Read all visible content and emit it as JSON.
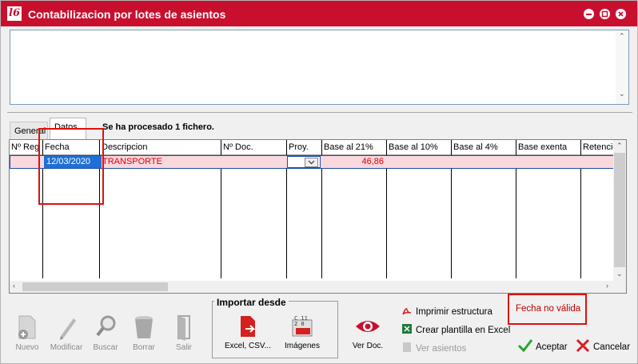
{
  "window": {
    "title": "Contabilizacion por lotes de asientos",
    "app_icon_text": "l6"
  },
  "tabs": [
    {
      "label": "General"
    },
    {
      "label": "Datos"
    }
  ],
  "status_message": "Se ha procesado 1 fichero.",
  "grid": {
    "columns": [
      "Nº Reg",
      "Fecha",
      "Descripcion",
      "Nº Doc.",
      "Proy.",
      "Base al  21%",
      "Base al 10%",
      "Base al 4%",
      "Base exenta",
      "Retención"
    ],
    "rows": [
      {
        "fecha": "12/03/2020",
        "descripcion": "TRANSPORTE",
        "base21": "46,86"
      }
    ]
  },
  "toolbar": {
    "nuevo": "Nuevo",
    "modificar": "Modificar",
    "buscar": "Buscar",
    "borrar": "Borrar",
    "salir": "Salir"
  },
  "import": {
    "title": "Importar desde",
    "excel": "Excel, CSV...",
    "imagenes": "Imágenes"
  },
  "ver_doc": "Ver Doc.",
  "links": {
    "imprimir": "Imprimir estructura",
    "crear_plantilla": "Crear plantilla en Excel",
    "ver_asientos": "Ver asientos"
  },
  "error_message": "Fecha no válida",
  "buttons": {
    "aceptar": "Aceptar",
    "cancelar": "Cancelar"
  },
  "colors": {
    "title_bar": "#c8102e",
    "error": "#e01010",
    "row_highlight": "#f9d8de",
    "selection": "#1e6fd6"
  }
}
